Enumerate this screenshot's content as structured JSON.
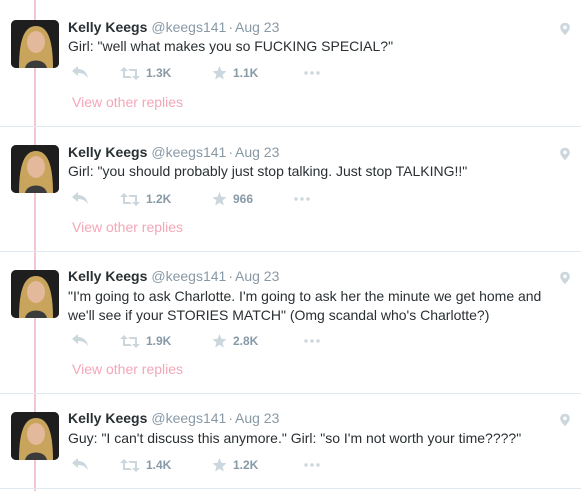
{
  "colors": {
    "thread_line": "#f4c6cf",
    "reply_link": "#f4a6b8",
    "meta_gray": "#8899a6",
    "text": "#292f33"
  },
  "icons": {
    "reply": "reply-icon",
    "retweet": "retweet-icon",
    "favorite": "star-icon",
    "more": "more-icon",
    "location": "location-pin-icon"
  },
  "tweets": [
    {
      "name": "Kelly Keegs",
      "handle": "@keegs141",
      "separator": "·",
      "time": "Aug 23",
      "text": "Girl: \"well what makes you so FUCKING SPECIAL?\"",
      "retweets": "1.3K",
      "favorites": "1.1K",
      "view_replies": "View other replies"
    },
    {
      "name": "Kelly Keegs",
      "handle": "@keegs141",
      "separator": "·",
      "time": "Aug 23",
      "text": "Girl: \"you should probably just stop talking. Just stop TALKING!!\"",
      "retweets": "1.2K",
      "favorites": "966",
      "view_replies": "View other replies"
    },
    {
      "name": "Kelly Keegs",
      "handle": "@keegs141",
      "separator": "·",
      "time": "Aug 23",
      "text_line1": "\"I'm going to ask Charlotte. I'm going to ask her the minute we get home and",
      "text_line2": "we'll see if your STORIES MATCH\" (Omg scandal who's Charlotte?)",
      "retweets": "1.9K",
      "favorites": "2.8K",
      "view_replies": "View other replies"
    },
    {
      "name": "Kelly Keegs",
      "handle": "@keegs141",
      "separator": "·",
      "time": "Aug 23",
      "text": "Guy: \"I can't discuss this anymore.\" Girl: \"so I'm not worth your time????\"",
      "retweets": "1.4K",
      "favorites": "1.2K"
    }
  ]
}
